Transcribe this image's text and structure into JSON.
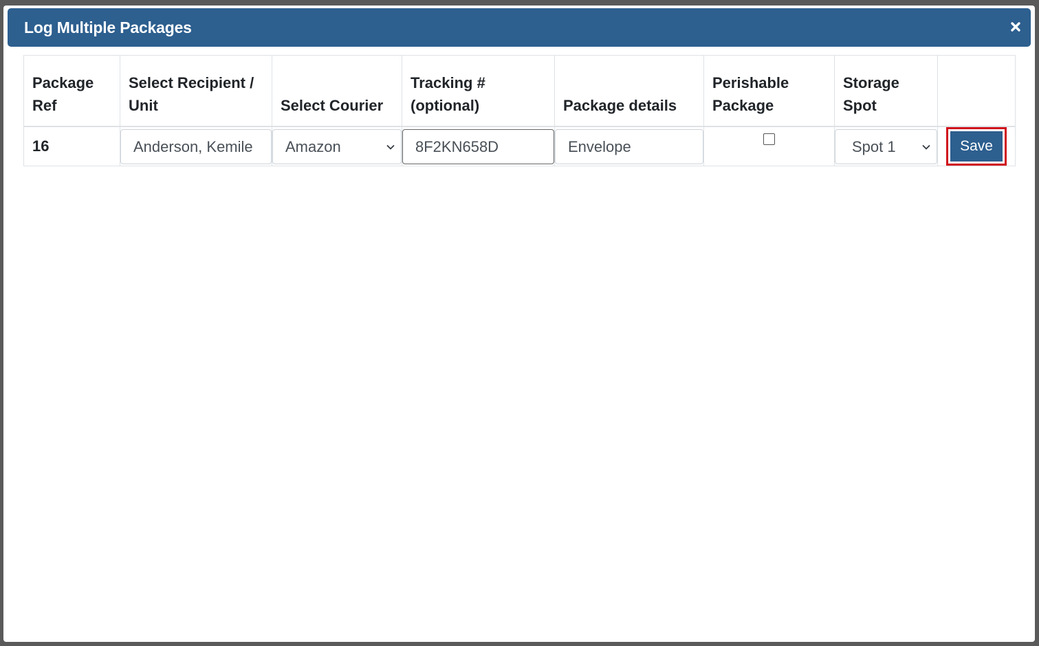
{
  "modal": {
    "title": "Log Multiple Packages",
    "close_icon": "close-icon",
    "accent_color": "#2d5f8f",
    "highlight_color": "#d0101a"
  },
  "table": {
    "headers": {
      "package_ref": "Package Ref",
      "recipient": "Select Recipient / Unit",
      "courier": "Select Courier",
      "tracking": "Tracking # (optional)",
      "details": "Package details",
      "perishable": "Perishable Package",
      "storage": "Storage Spot",
      "action": ""
    },
    "rows": [
      {
        "ref": "16",
        "recipient": "Anderson, Kemile",
        "courier": "Amazon",
        "tracking": "8F2KN658D",
        "details": "Envelope",
        "perishable": false,
        "storage": "Spot 1",
        "save_label": "Save"
      }
    ]
  }
}
